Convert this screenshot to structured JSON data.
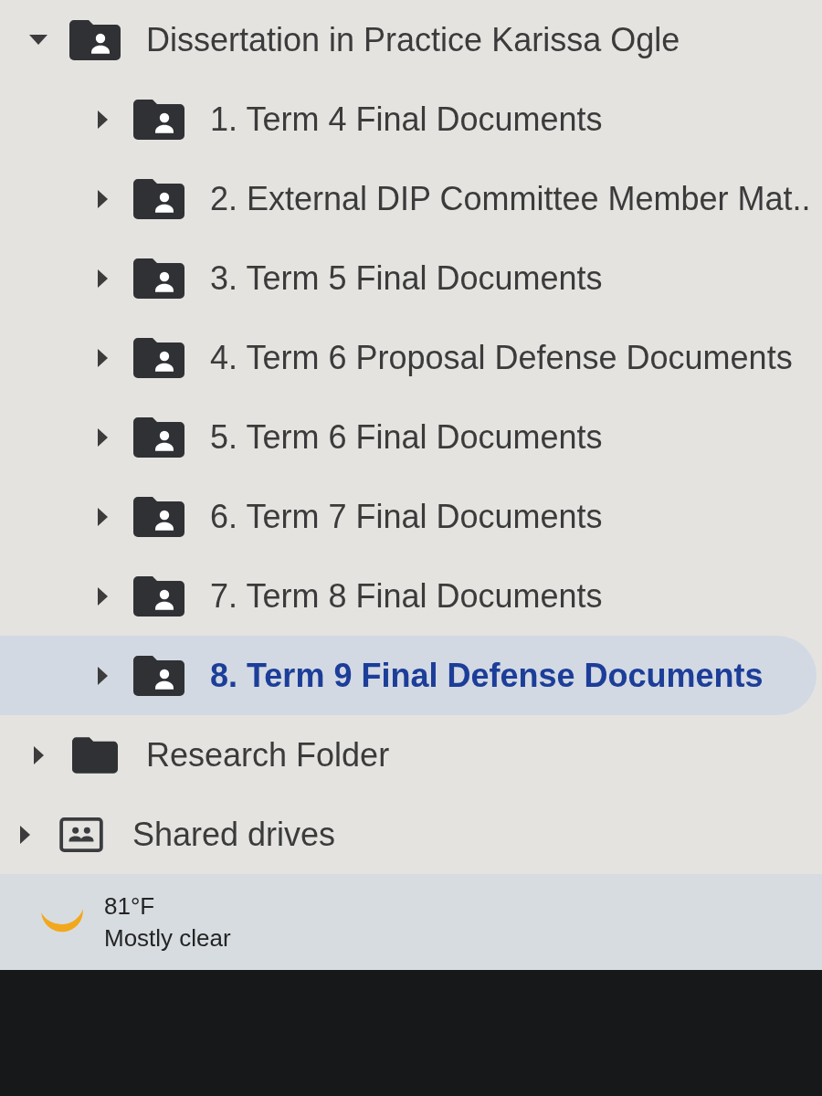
{
  "nav_tree": [
    {
      "kind": "shared-folder",
      "label": "Dissertation in Practice Karissa Ogle",
      "expanded": true,
      "selected": false,
      "children": [
        {
          "kind": "shared-folder",
          "label": "1. Term 4 Final Documents",
          "expanded": false,
          "selected": false
        },
        {
          "kind": "shared-folder",
          "label": "2. External DIP Committee Member Mat..",
          "expanded": false,
          "selected": false
        },
        {
          "kind": "shared-folder",
          "label": "3. Term 5 Final Documents",
          "expanded": false,
          "selected": false
        },
        {
          "kind": "shared-folder",
          "label": "4. Term 6 Proposal Defense Documents",
          "expanded": false,
          "selected": false
        },
        {
          "kind": "shared-folder",
          "label": "5. Term 6 Final Documents",
          "expanded": false,
          "selected": false
        },
        {
          "kind": "shared-folder",
          "label": "6. Term 7 Final Documents",
          "expanded": false,
          "selected": false
        },
        {
          "kind": "shared-folder",
          "label": "7. Term 8 Final Documents",
          "expanded": false,
          "selected": false
        },
        {
          "kind": "shared-folder",
          "label": "8. Term 9 Final Defense Documents",
          "expanded": false,
          "selected": true
        }
      ]
    },
    {
      "kind": "folder",
      "label": "Research Folder",
      "expanded": false,
      "selected": false
    }
  ],
  "shared_drives": {
    "label": "Shared drives",
    "expanded": false,
    "selected": false
  },
  "taskbar": {
    "weather": {
      "temperature": "81°F",
      "condition": "Mostly clear"
    }
  }
}
